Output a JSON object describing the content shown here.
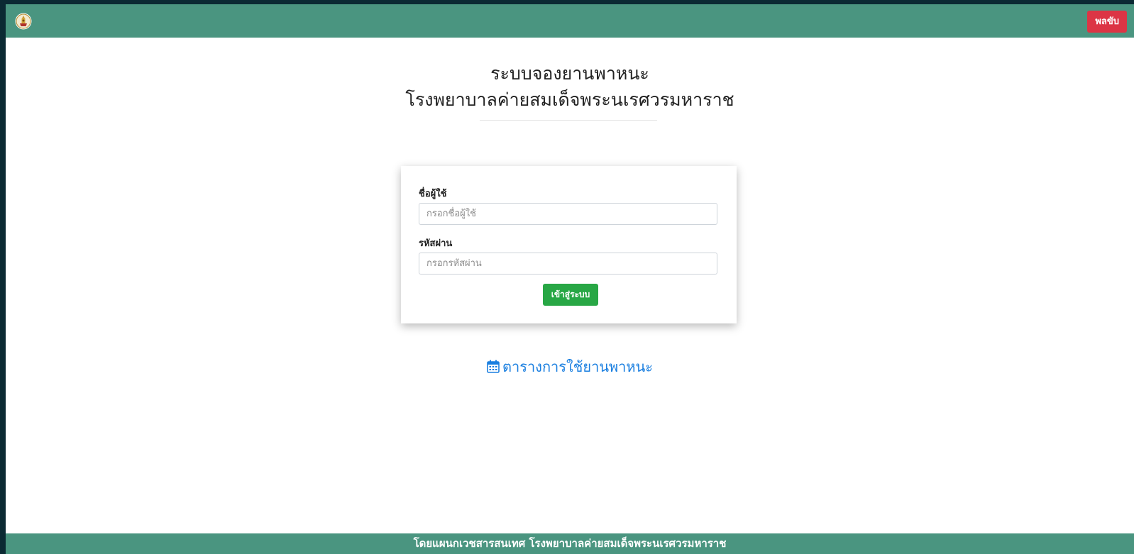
{
  "header": {
    "logo_icon": "royal-emblem-icon",
    "toggle_label": "พลขับ",
    "toggle_color": "#dc3545",
    "bar_color": "#4a9580"
  },
  "title": {
    "line1": "ระบบจองยานพาหนะ",
    "line2": "โรงพยาบาลค่ายสมเด็จพระนเรศวรมหาราช"
  },
  "login_form": {
    "username_label": "ชื่อผู้ใช้",
    "username_placeholder": "กรอกชื่อผู้ใช้",
    "username_value": "",
    "password_label": "รหัสผ่าน",
    "password_placeholder": "กรอกรหัสผ่าน",
    "password_value": "",
    "submit_label": "เข้าสู่ระบบ",
    "submit_color": "#28a745"
  },
  "schedule_link": {
    "icon": "calendar-icon",
    "label": "ตารางการใช้ยานพาหนะ",
    "color": "#1a7fe0"
  },
  "footer": {
    "text": "โดยแผนกเวชสารสนเทศ โรงพยาบาลค่ายสมเด็จพระนเรศวรมหาราช"
  }
}
